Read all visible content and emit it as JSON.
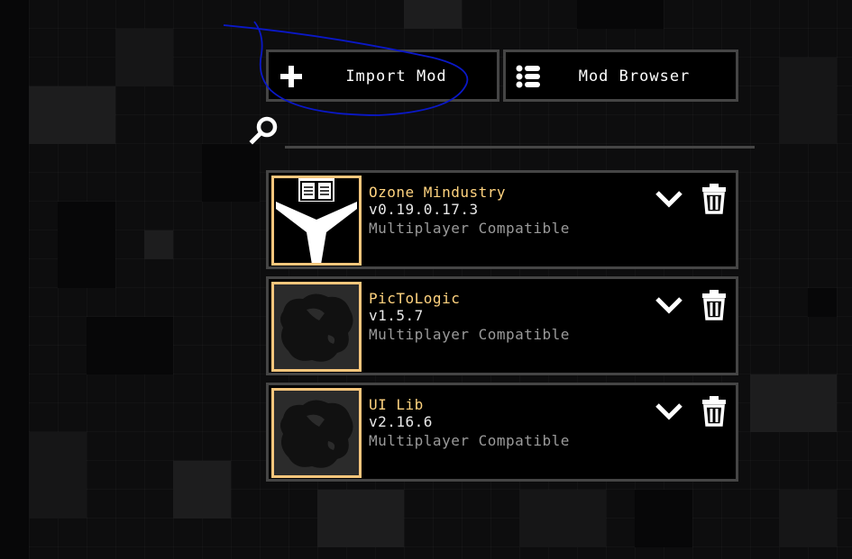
{
  "toolbar": {
    "import_label": "Import Mod",
    "browser_label": "Mod Browser"
  },
  "search": {
    "value": "",
    "placeholder": ""
  },
  "mods": [
    {
      "name": "Ozone Mindustry",
      "version": "v0.19.0.17.3",
      "compat": "Multiplayer Compatible",
      "icon": "ozone-logo-icon"
    },
    {
      "name": "PicToLogic",
      "version": "v1.5.7",
      "compat": "Multiplayer Compatible",
      "icon": "default-mod-icon"
    },
    {
      "name": "UI Lib",
      "version": "v2.16.6",
      "compat": "Multiplayer Compatible",
      "icon": "default-mod-icon"
    }
  ],
  "colors": {
    "accent": "#f8c67c",
    "name": "#ffd37f",
    "border": "#454545",
    "annotation": "#0a18c8"
  }
}
